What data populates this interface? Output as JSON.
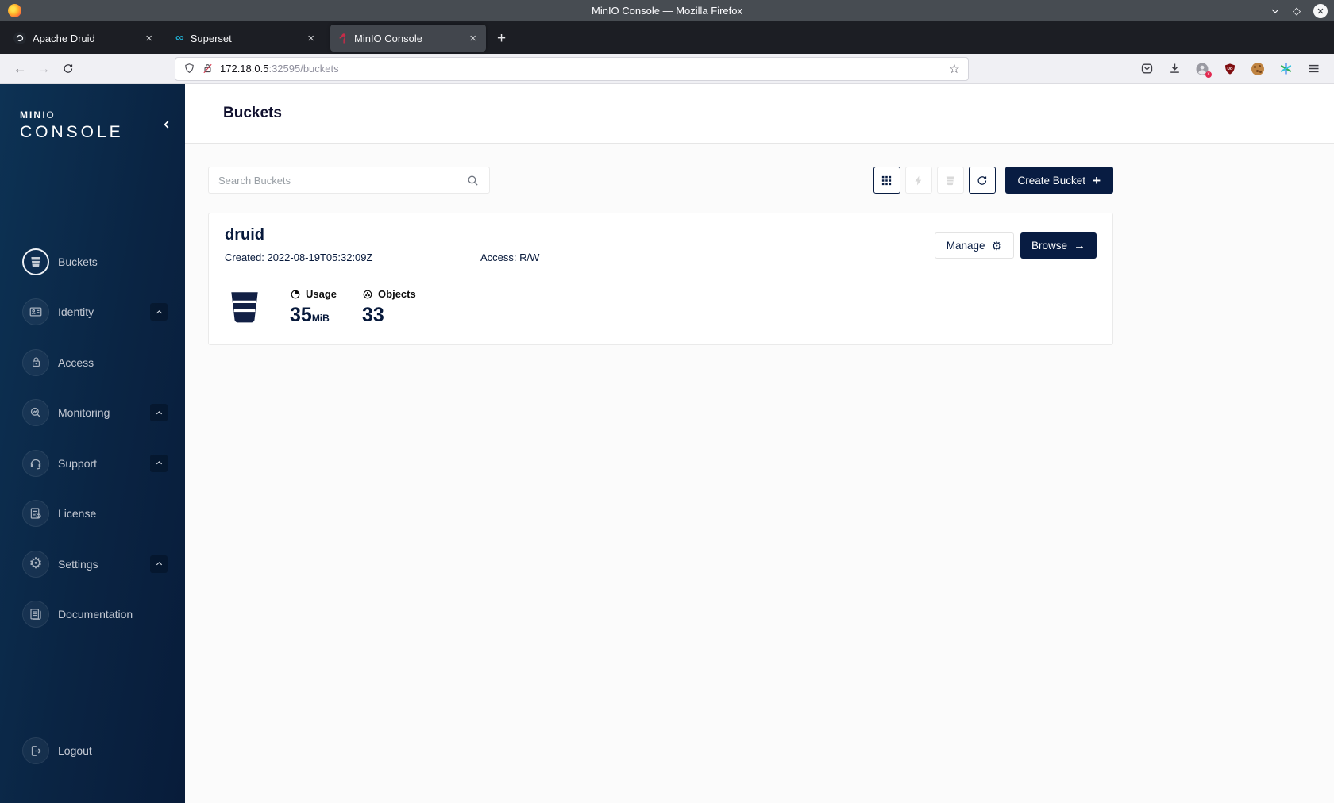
{
  "window": {
    "title": "MinIO Console — Mozilla Firefox",
    "tabs": [
      {
        "label": "Apache Druid",
        "close": "×"
      },
      {
        "label": "Superset",
        "close": "×"
      },
      {
        "label": "MinIO Console",
        "close": "×"
      }
    ],
    "new_tab": "+",
    "url": {
      "host": "172.18.0.5",
      "rest": ":32595/buckets"
    },
    "nav": {
      "back": "←",
      "forward": "→",
      "star": "☆"
    },
    "win_controls": {
      "maximize": "◇"
    }
  },
  "sidebar": {
    "logo_min": "MIN",
    "logo_io": "IO",
    "logo_console": "CONSOLE",
    "items": [
      {
        "label": "Buckets"
      },
      {
        "label": "Identity"
      },
      {
        "label": "Access"
      },
      {
        "label": "Monitoring"
      },
      {
        "label": "Support"
      },
      {
        "label": "License"
      },
      {
        "label": "Settings"
      },
      {
        "label": "Documentation"
      }
    ],
    "logout_label": "Logout",
    "gear_glyph": "⚙"
  },
  "main": {
    "page_title": "Buckets",
    "search_placeholder": "Search Buckets",
    "create_button_label": "Create Bucket",
    "create_plus": "+",
    "bucket": {
      "name": "druid",
      "created_label": "Created: 2022-08-19T05:32:09Z",
      "access_label": "Access: R/W",
      "manage_label": "Manage",
      "manage_gear": "⚙",
      "browse_label": "Browse",
      "browse_arrow": "→",
      "usage_label": "Usage",
      "usage_value": "35",
      "usage_unit": "MiB",
      "objects_label": "Objects",
      "objects_value": "33"
    }
  },
  "colors": {
    "accent_navy": "#081C42",
    "sidebar_gradient_start": "#0D3254",
    "sidebar_gradient_end": "#081C3A",
    "flamingo_red": "#C72C48",
    "superset_teal": "#20A7C9",
    "ublock_red": "#7F0D10"
  }
}
